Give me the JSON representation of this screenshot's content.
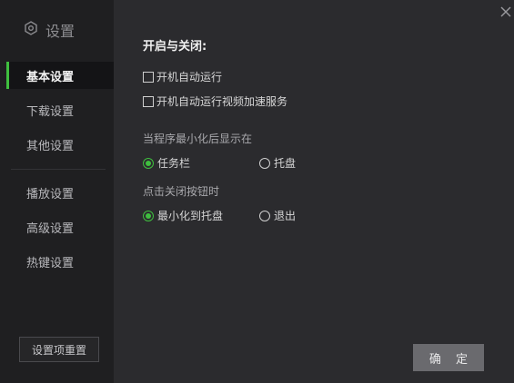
{
  "sidebar": {
    "title": "设置",
    "title_icon": "settings-hex-icon",
    "items": [
      {
        "label": "基本设置",
        "active": true
      },
      {
        "label": "下载设置",
        "active": false
      },
      {
        "label": "其他设置",
        "active": false
      },
      {
        "label": "播放设置",
        "active": false
      },
      {
        "label": "高级设置",
        "active": false
      },
      {
        "label": "热键设置",
        "active": false
      }
    ],
    "reset_label": "设置项重置"
  },
  "main": {
    "section_title": "开启与关闭:",
    "checkboxes": [
      {
        "label": "开机自动运行",
        "checked": false
      },
      {
        "label": "开机自动运行视频加速服务",
        "checked": false
      }
    ],
    "minimize_group": {
      "label": "当程序最小化后显示在",
      "options": [
        {
          "label": "任务栏",
          "selected": true
        },
        {
          "label": "托盘",
          "selected": false
        }
      ]
    },
    "close_group": {
      "label": "点击关闭按钮时",
      "options": [
        {
          "label": "最小化到托盘",
          "selected": true
        },
        {
          "label": "退出",
          "selected": false
        }
      ]
    },
    "ok_label": "确 定"
  },
  "window": {
    "close_icon": "close-icon"
  },
  "colors": {
    "accent": "#3fbf3f",
    "sidebar_bg": "#1f1f21",
    "content_bg": "#2b2b2e",
    "active_item_bg": "#141416"
  }
}
